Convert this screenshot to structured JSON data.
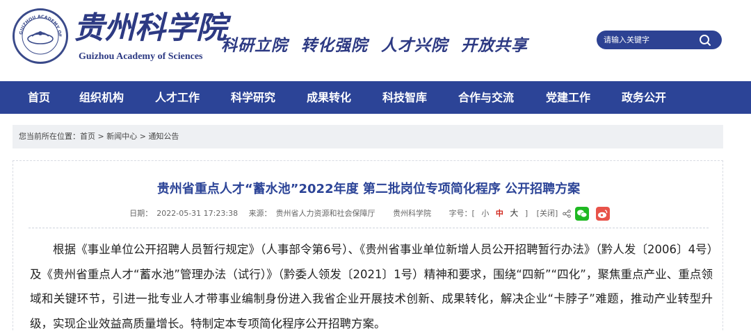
{
  "header": {
    "brand_cn": "贵州科学院",
    "brand_en": "Guizhou Academy of Sciences",
    "seal_text": "GUIZHOU ACADEMY OF SCIENCES",
    "slogan": "科研立院 转化强院 人才兴院 开放共享",
    "search_placeholder": "请输入关键字"
  },
  "nav": {
    "items": [
      "首页",
      "组织机构",
      "人才工作",
      "科学研究",
      "成果转化",
      "科技智库",
      "合作与交流",
      "党建工作",
      "政务公开"
    ]
  },
  "breadcrumb": {
    "prefix": "您当前所在位置：",
    "items": [
      "首页",
      "新闻中心",
      "通知公告"
    ],
    "separator": ">"
  },
  "article": {
    "title": "贵州省重点人才“蓄水池”2022年度 第二批岗位专项简化程序 公开招聘方案",
    "date_label": "日期：",
    "date": "2022-05-31 17:23:38",
    "source_label": "来源：",
    "source": "贵州省人力资源和社会保障厅",
    "author": "贵州科学院",
    "font_label": "字号：[",
    "font_small": "小",
    "font_mid": "中",
    "font_big": "大",
    "font_close": "]",
    "close": "[关闭]",
    "body": "根据《事业单位公开招聘人员暂行规定》（人事部令第6号）、《贵州省事业单位新增人员公开招聘暂行办法》（黔人发〔2006〕4号）及《贵州省重点人才“蓄水池”管理办法（试行）》（黔委人领发〔2021〕1号）精神和要求，围绕“四新”“四化”，聚焦重点产业、重点领域和关键环节，引进一批专业人才带事业编制身份进入我省企业开展技术创新、成果转化，解决企业“卡脖子”难题，推动产业转型升级，实现企业效益高质量增长。特制定本专项简化程序公开招聘方案。"
  },
  "colors": {
    "brand_blue": "#2c4497",
    "nav_bg": "#2c4497",
    "accent_red": "#d0261c",
    "wechat_green": "#1fb922",
    "weibo_red": "#e8534a"
  },
  "icons": {
    "logo": "academy-seal-icon",
    "search": "search-icon",
    "share": "share-icon",
    "wechat": "wechat-icon",
    "weibo": "weibo-icon"
  }
}
